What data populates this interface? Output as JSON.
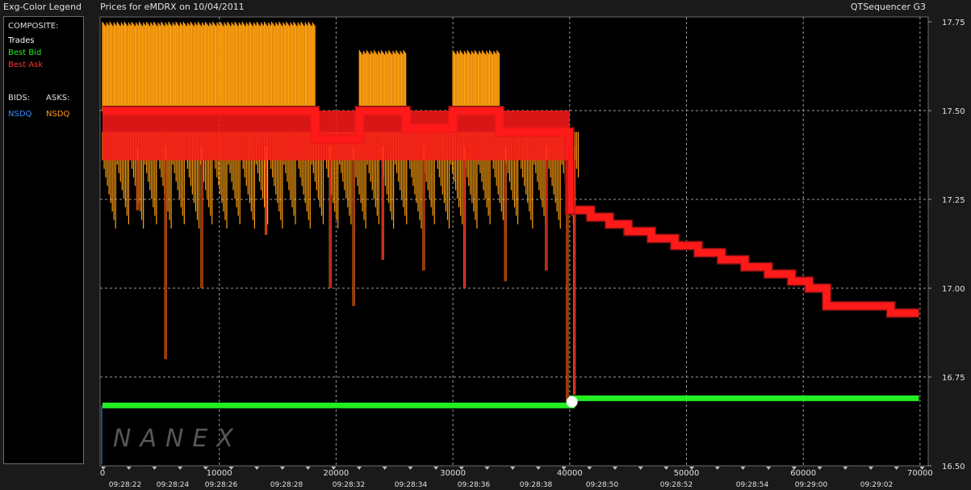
{
  "header": {
    "legend_title": "Exg-Color Legend",
    "chart_title": "Prices for  eMDRX  on  10/04/2011",
    "app_title": "QTSequencer G3"
  },
  "legend": {
    "composite_label": "COMPOSITE:",
    "trades": {
      "label": "Trades",
      "color": "#ffffff"
    },
    "best_bid": {
      "label": "Best Bid",
      "color": "#22ee22"
    },
    "best_ask": {
      "label": "Best Ask",
      "color": "#ff2020"
    },
    "bids_label": "BIDS:",
    "asks_label": "ASKS:",
    "bid_exchange": {
      "label": "NSDQ",
      "color": "#3a8fff"
    },
    "ask_exchange": {
      "label": "NSDQ",
      "color": "#ff9a1a"
    }
  },
  "watermark": "NANEX",
  "chart_data": {
    "type": "line",
    "x_axis": {
      "ticks": [
        0,
        10000,
        20000,
        30000,
        40000,
        50000,
        60000,
        70000
      ],
      "time_labels": [
        "09:28:22",
        "09:28:24",
        "09:28:26",
        "09:28:28",
        "09:28:32",
        "09:28:34",
        "09:28:36",
        "09:28:38",
        "09:28:50",
        "09:28:52",
        "09:28:54",
        "09:29:00",
        "09:29:02"
      ]
    },
    "y_axis": {
      "ticks": [
        "17.75",
        "17.50",
        "17.25",
        "17.00",
        "16.75",
        "16.50"
      ],
      "ylim": [
        16.5,
        17.75
      ]
    },
    "x_range": [
      0,
      70700
    ],
    "grid": true,
    "colors": {
      "trades": "#ffa010",
      "best_bid": "#22ee22",
      "best_ask": "#ff1a1a",
      "background": "#000000",
      "grid": "#9a9a9a"
    },
    "series": [
      {
        "name": "Best Bid",
        "points": [
          [
            0,
            16.67
          ],
          [
            40200,
            16.67
          ],
          [
            40200,
            16.69
          ],
          [
            69900,
            16.69
          ]
        ]
      },
      {
        "name": "Best Ask",
        "points": [
          [
            0,
            17.5
          ],
          [
            18200,
            17.5
          ],
          [
            18200,
            17.42
          ],
          [
            22000,
            17.42
          ],
          [
            22000,
            17.5
          ],
          [
            26000,
            17.5
          ],
          [
            26000,
            17.45
          ],
          [
            30000,
            17.45
          ],
          [
            30000,
            17.5
          ],
          [
            34000,
            17.5
          ],
          [
            34000,
            17.44
          ],
          [
            40000,
            17.44
          ],
          [
            40000,
            17.22
          ],
          [
            41800,
            17.22
          ],
          [
            41800,
            17.2
          ],
          [
            43400,
            17.2
          ],
          [
            43400,
            17.18
          ],
          [
            45000,
            17.18
          ],
          [
            45000,
            17.16
          ],
          [
            47000,
            17.16
          ],
          [
            47000,
            17.14
          ],
          [
            49000,
            17.14
          ],
          [
            49000,
            17.12
          ],
          [
            51000,
            17.12
          ],
          [
            51000,
            17.1
          ],
          [
            53000,
            17.1
          ],
          [
            53000,
            17.08
          ],
          [
            55000,
            17.08
          ],
          [
            55000,
            17.06
          ],
          [
            57000,
            17.06
          ],
          [
            57000,
            17.04
          ],
          [
            59000,
            17.04
          ],
          [
            59000,
            17.02
          ],
          [
            60500,
            17.02
          ],
          [
            60500,
            17.0
          ],
          [
            62000,
            17.0
          ],
          [
            62000,
            16.95
          ],
          [
            67500,
            16.95
          ],
          [
            67500,
            16.93
          ],
          [
            69900,
            16.93
          ]
        ]
      },
      {
        "name": "Trades",
        "x_range": [
          0,
          40800
        ],
        "price_range": [
          16.68,
          17.75
        ],
        "clusters": [
          [
            0,
            18200,
            17.75
          ],
          [
            22000,
            26000,
            17.67
          ],
          [
            30000,
            34000,
            17.67
          ]
        ],
        "dips": [
          [
            3000,
            17.22
          ],
          [
            5400,
            16.8
          ],
          [
            8500,
            17.0
          ],
          [
            14000,
            17.15
          ],
          [
            19500,
            17.0
          ],
          [
            21500,
            16.95
          ],
          [
            24000,
            17.08
          ],
          [
            27500,
            17.05
          ],
          [
            31000,
            17.0
          ],
          [
            34500,
            17.02
          ],
          [
            38000,
            17.05
          ],
          [
            39800,
            16.68
          ],
          [
            40400,
            16.7
          ]
        ]
      }
    ]
  }
}
